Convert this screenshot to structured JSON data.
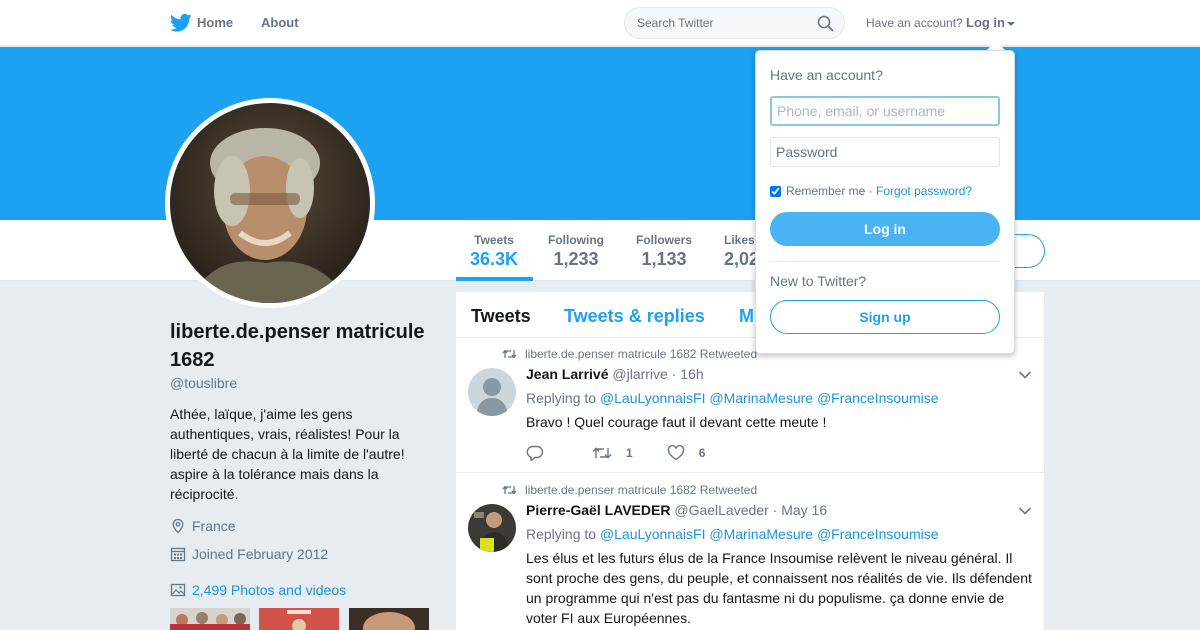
{
  "topbar": {
    "home_label": "Home",
    "about_label": "About",
    "search_placeholder": "Search Twitter",
    "have_account": "Have an account?",
    "login_label": "Log in"
  },
  "colors": {
    "brand": "#1da1f2",
    "banner": "#1da1f2",
    "link": "#1b95e0"
  },
  "profile": {
    "name": "liberte.de.penser matricule 1682",
    "handle": "@touslibre",
    "bio": "Athée, laïque, j'aime les gens authentiques, vrais, réalistes! Pour la liberté de chacun à la limite de l'autre! aspire à la tolérance mais dans la réciprocité.",
    "location": "France",
    "joined": "Joined February 2012",
    "photos_videos": "2,499 Photos and videos"
  },
  "stats": [
    {
      "label": "Tweets",
      "value": "36.3K",
      "active": true
    },
    {
      "label": "Following",
      "value": "1,233"
    },
    {
      "label": "Followers",
      "value": "1,133"
    },
    {
      "label": "Likes",
      "value": "2,02"
    }
  ],
  "timeline": {
    "tabs": [
      {
        "label": "Tweets",
        "active": true
      },
      {
        "label": "Tweets & replies"
      },
      {
        "label": "M"
      }
    ],
    "tweets": [
      {
        "retweet_by": "liberte.de.penser matricule 1682 Retweeted",
        "fullname": "Jean Larrivé",
        "username": "@jlarrive",
        "time": "· 16h",
        "replying_prefix": "Replying to",
        "mentions": "@LauLyonnaisFI @MarinaMesure @FranceInsoumise",
        "text": "Bravo ! Quel courage faut il devant cette meute !",
        "retweets": "1",
        "likes": "6"
      },
      {
        "retweet_by": "liberte.de.penser matricule 1682 Retweeted",
        "fullname": "Pierre-Gaël LAVEDER",
        "username": "@GaelLaveder",
        "time": "· May 16",
        "replying_prefix": "Replying to",
        "mentions": "@LauLyonnaisFI @MarinaMesure @FranceInsoumise",
        "text": "Les élus et les futurs élus de la France Insoumise relèvent le niveau général. Il sont proche des gens, du peuple, et connaissent nos réalités de vie. Ils défendent un programme qui n'est pas du fantasme ni du populisme. ça donne envie de voter FI aux Européennes."
      }
    ]
  },
  "login_dropdown": {
    "title": "Have an account?",
    "username_placeholder": "Phone, email, or username",
    "password_placeholder": "Password",
    "remember_label": "Remember me",
    "separator": "·",
    "forgot_label": "Forgot password?",
    "login_button": "Log in",
    "new_label": "New to Twitter?",
    "signup_button": "Sign up"
  }
}
